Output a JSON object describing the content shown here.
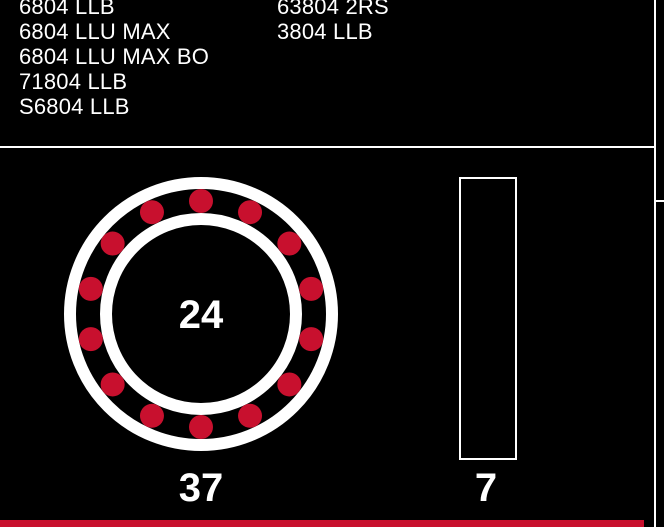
{
  "parts": {
    "column_1": [
      "6804 LLB",
      "6804 LLU MAX",
      "6804 LLU MAX BO",
      "71804 LLB",
      "S6804 LLB"
    ],
    "column_2": [
      "63804 2RS",
      "3804 LLB"
    ]
  },
  "bearing": {
    "inner_diameter": "24",
    "outer_diameter": "37",
    "width": "7",
    "ball_count": 14,
    "ball_color": "#c8102e",
    "ring_color": "#ffffff"
  },
  "colors": {
    "background": "#000000",
    "accent": "#c8102e",
    "foreground": "#ffffff"
  }
}
